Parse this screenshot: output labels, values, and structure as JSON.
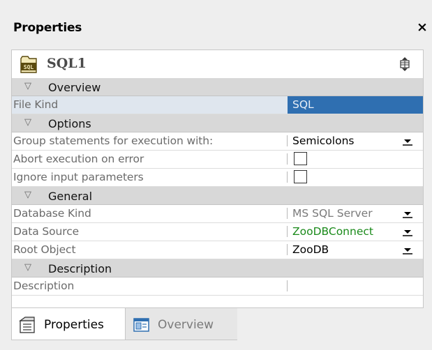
{
  "window": {
    "title": "Properties",
    "close_glyph": "×"
  },
  "object": {
    "icon": "sql-file-icon",
    "icon_label": "SQL",
    "name": "SQL1"
  },
  "categories": [
    {
      "label": "Overview",
      "properties": [
        {
          "name": "File Kind",
          "value": "SQL",
          "selected": true
        }
      ]
    },
    {
      "label": "Options",
      "properties": [
        {
          "name": "Group statements for execution with:",
          "value": "Semicolons",
          "control": "dropdown"
        },
        {
          "name": "Abort execution on error",
          "control": "checkbox",
          "checked": false
        },
        {
          "name": "Ignore input parameters",
          "control": "checkbox",
          "checked": false
        }
      ]
    },
    {
      "label": "General",
      "properties": [
        {
          "name": "Database Kind",
          "value": "MS SQL Server",
          "control": "dropdown"
        },
        {
          "name": "Data Source",
          "value": "ZooDBConnect",
          "control": "dropdown"
        },
        {
          "name": "Root Object",
          "value": "ZooDB",
          "control": "dropdown"
        }
      ]
    },
    {
      "label": "Description",
      "properties": [
        {
          "name": "Description",
          "value": ""
        }
      ]
    }
  ],
  "tabs": [
    {
      "label": "Properties",
      "icon": "properties-icon",
      "active": true
    },
    {
      "label": "Overview",
      "icon": "overview-icon",
      "active": false
    }
  ],
  "colors": {
    "selection": "#2f6fb1",
    "category_bg": "#d8d8d8",
    "data_source_value": "#1a8a1a"
  }
}
